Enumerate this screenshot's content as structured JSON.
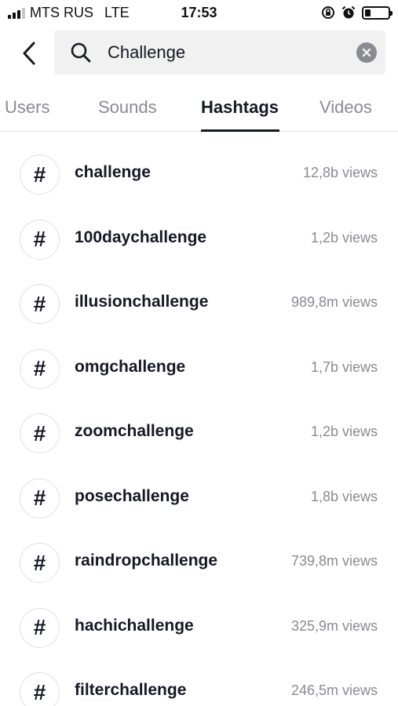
{
  "status_bar": {
    "carrier": "MTS RUS",
    "network": "LTE",
    "time": "17:53",
    "signal_bars_filled": 3,
    "signal_bars_total": 4,
    "battery_level": 0.25
  },
  "header": {
    "back_icon": "chevron-left-icon",
    "search_icon": "search-icon",
    "clear_icon": "clear-circle-icon"
  },
  "search": {
    "query": "Challenge"
  },
  "tabs": [
    {
      "label": "Users",
      "active": false
    },
    {
      "label": "Sounds",
      "active": false
    },
    {
      "label": "Hashtags",
      "active": true
    },
    {
      "label": "Videos",
      "active": false
    }
  ],
  "hashtags": [
    {
      "symbol": "#",
      "name": "challenge",
      "views": "12,8b views"
    },
    {
      "symbol": "#",
      "name": "100daychallenge",
      "views": "1,2b views"
    },
    {
      "symbol": "#",
      "name": "illusionchallenge",
      "views": "989,8m views"
    },
    {
      "symbol": "#",
      "name": "omgchallenge",
      "views": "1,7b views"
    },
    {
      "symbol": "#",
      "name": "zoomchallenge",
      "views": "1,2b views"
    },
    {
      "symbol": "#",
      "name": "posechallenge",
      "views": "1,8b views"
    },
    {
      "symbol": "#",
      "name": "raindropchallenge",
      "views": "739,8m views"
    },
    {
      "symbol": "#",
      "name": "hachichallenge",
      "views": "325,9m views"
    },
    {
      "symbol": "#",
      "name": "filterchallenge",
      "views": "246,5m views"
    }
  ],
  "colors": {
    "text_primary": "#161823",
    "text_secondary": "#8a8b91",
    "search_bg": "#f1f1f2",
    "divider": "#e3e3e4"
  }
}
